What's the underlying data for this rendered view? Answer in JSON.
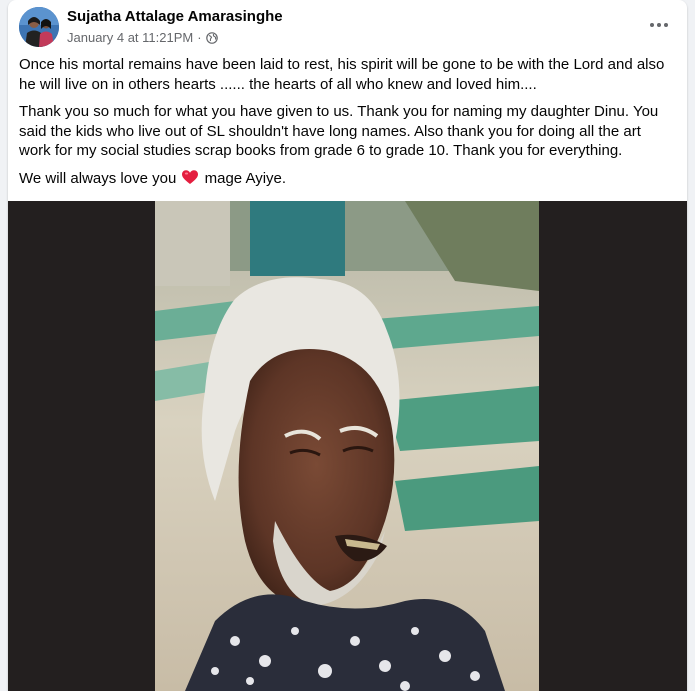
{
  "post": {
    "author": "Sujatha Attalage Amarasinghe",
    "timestamp": "January 4 at 11:21PM",
    "separator": "·",
    "privacy_icon": "globe-icon",
    "more_icon": "more-options-icon",
    "paragraphs": {
      "p1": "Once his mortal remains have been laid to rest, his spirit will be gone to be with the Lord and also he will  live on in others hearts ...... the hearts of all who knew and loved him....",
      "p2": "Thank you so much for what you have given to us. Thank you for naming my daughter Dinu. You said the kids who live out of SL shouldn't have long names. Also thank you for doing all the art work for my social studies scrap books from grade 6 to grade 10. Thank you for everything.",
      "p3_before": "We will always love you",
      "p3_after": "mage Ayiye."
    },
    "heart_emoji": "red-heart-icon"
  },
  "colors": {
    "background": "#f0f2f5",
    "card": "#ffffff",
    "text_primary": "#050505",
    "text_secondary": "#65676b",
    "photo_frame": "#231f1f",
    "heart": "#e41e3f"
  }
}
